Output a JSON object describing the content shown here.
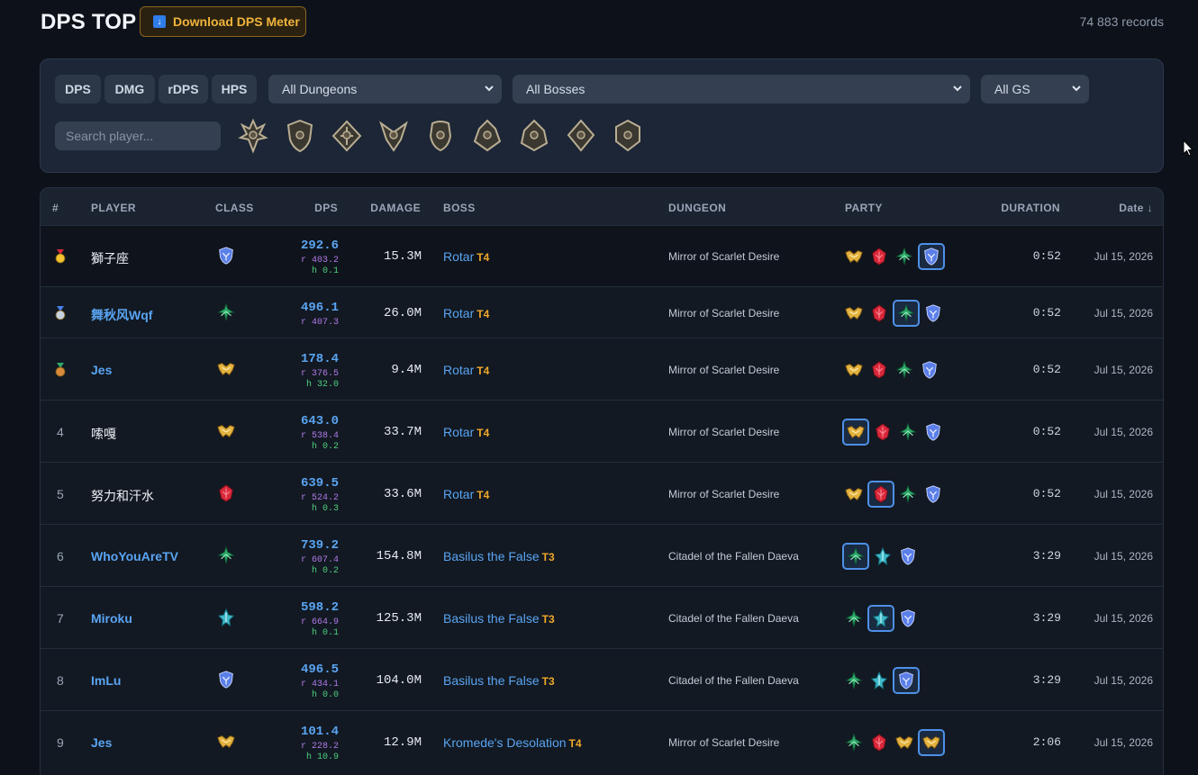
{
  "header": {
    "title": "DPS TOP",
    "download_label": "Download DPS Meter",
    "download_icon": "download-icon",
    "records": "74 883 records"
  },
  "filters": {
    "metric_tabs": [
      "DPS",
      "DMG",
      "rDPS",
      "HPS"
    ],
    "dungeon_select": "All Dungeons",
    "boss_select": "All Bosses",
    "gs_select": "All GS",
    "search_placeholder": "Search player...",
    "class_icons": [
      "gladiator-icon",
      "templar-icon",
      "ranger-icon",
      "assassin-icon",
      "bard-icon",
      "cleric-icon",
      "chanter-icon",
      "sorcerer-icon",
      "spiritmaster-icon"
    ]
  },
  "table": {
    "columns": [
      "#",
      "PLAYER",
      "CLASS",
      "DPS",
      "DAMAGE",
      "BOSS",
      "DUNGEON",
      "PARTY",
      "DURATION",
      "Date ↓"
    ],
    "rows": [
      {
        "rank": "1",
        "medal": "gold",
        "player": "獅子座",
        "player_color": "white",
        "class": "shield",
        "dps": "292.6",
        "rdps": "r 403.2",
        "hps": "h 0.1",
        "damage": "15.3M",
        "boss": "Rotar",
        "tier": "T4",
        "dungeon": "Mirror of Scarlet Desire",
        "party": [
          "wing",
          "fist",
          "tree",
          "shield"
        ],
        "party_sel": 3,
        "duration": "0:52",
        "date": "Jul 15, 2026"
      },
      {
        "rank": "2",
        "medal": "silver",
        "player": "舞秋风Wqf",
        "player_color": "blue",
        "class": "tree",
        "dps": "496.1",
        "rdps": "r 407.3",
        "hps": "",
        "damage": "26.0M",
        "boss": "Rotar",
        "tier": "T4",
        "dungeon": "Mirror of Scarlet Desire",
        "party": [
          "wing",
          "fist",
          "tree",
          "shield"
        ],
        "party_sel": 2,
        "duration": "0:52",
        "date": "Jul 15, 2026"
      },
      {
        "rank": "3",
        "medal": "bronze",
        "player": "Jes",
        "player_color": "blue",
        "class": "wing",
        "dps": "178.4",
        "rdps": "r 376.5",
        "hps": "h 32.0",
        "damage": "9.4M",
        "boss": "Rotar",
        "tier": "T4",
        "dungeon": "Mirror of Scarlet Desire",
        "party": [
          "wing",
          "fist",
          "tree",
          "shield"
        ],
        "party_sel": -1,
        "duration": "0:52",
        "date": "Jul 15, 2026"
      },
      {
        "rank": "4",
        "medal": "",
        "player": "嗦嘎",
        "player_color": "white",
        "class": "wing",
        "dps": "643.0",
        "rdps": "r 538.4",
        "hps": "h 0.2",
        "damage": "33.7M",
        "boss": "Rotar",
        "tier": "T4",
        "dungeon": "Mirror of Scarlet Desire",
        "party": [
          "wing",
          "fist",
          "tree",
          "shield"
        ],
        "party_sel": 0,
        "duration": "0:52",
        "date": "Jul 15, 2026"
      },
      {
        "rank": "5",
        "medal": "",
        "player": "努力和汗水",
        "player_color": "white",
        "class": "fist",
        "dps": "639.5",
        "rdps": "r 524.2",
        "hps": "h 0.3",
        "damage": "33.6M",
        "boss": "Rotar",
        "tier": "T4",
        "dungeon": "Mirror of Scarlet Desire",
        "party": [
          "wing",
          "fist",
          "tree",
          "shield"
        ],
        "party_sel": 1,
        "duration": "0:52",
        "date": "Jul 15, 2026"
      },
      {
        "rank": "6",
        "medal": "",
        "player": "WhoYouAreTV",
        "player_color": "blue",
        "class": "tree",
        "dps": "739.2",
        "rdps": "r 607.4",
        "hps": "h 0.2",
        "damage": "154.8M",
        "boss": "Basilus the False",
        "tier": "T3",
        "dungeon": "Citadel of the Fallen Daeva",
        "party": [
          "tree",
          "crystal",
          "shield"
        ],
        "party_sel": 0,
        "duration": "3:29",
        "date": "Jul 15, 2026"
      },
      {
        "rank": "7",
        "medal": "",
        "player": "Miroku",
        "player_color": "blue",
        "class": "crystal",
        "dps": "598.2",
        "rdps": "r 664.9",
        "hps": "h 0.1",
        "damage": "125.3M",
        "boss": "Basilus the False",
        "tier": "T3",
        "dungeon": "Citadel of the Fallen Daeva",
        "party": [
          "tree",
          "crystal",
          "shield"
        ],
        "party_sel": 1,
        "duration": "3:29",
        "date": "Jul 15, 2026"
      },
      {
        "rank": "8",
        "medal": "",
        "player": "ImLu",
        "player_color": "blue",
        "class": "shield",
        "dps": "496.5",
        "rdps": "r 434.1",
        "hps": "h 0.0",
        "damage": "104.0M",
        "boss": "Basilus the False",
        "tier": "T3",
        "dungeon": "Citadel of the Fallen Daeva",
        "party": [
          "tree",
          "crystal",
          "shield"
        ],
        "party_sel": 2,
        "duration": "3:29",
        "date": "Jul 15, 2026"
      },
      {
        "rank": "9",
        "medal": "",
        "player": "Jes",
        "player_color": "blue",
        "class": "wing",
        "dps": "101.4",
        "rdps": "r 228.2",
        "hps": "h 10.9",
        "damage": "12.9M",
        "boss": "Kromede's Desolation",
        "tier": "T4",
        "dungeon": "Mirror of Scarlet Desire",
        "party": [
          "tree",
          "fist",
          "wing",
          "wing"
        ],
        "party_sel": 3,
        "duration": "2:06",
        "date": "Jul 15, 2026"
      }
    ]
  },
  "colors": {
    "accent_blue": "#5aa4f2",
    "tier_orange": "#f0a82a",
    "rdps_purple": "#b07ae8",
    "hps_green": "#4fcf7f",
    "wing_gold": "#e3b340",
    "fist_red": "#d8283a",
    "tree_green": "#2fa86a",
    "crystal_teal": "#3fb8c8",
    "shield_blue": "#5b7fe8"
  }
}
